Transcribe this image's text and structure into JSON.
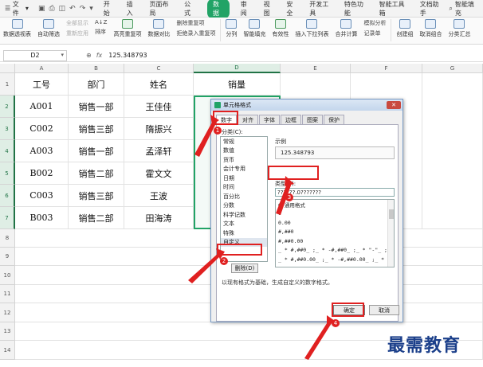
{
  "toolbar": {
    "file_label": "文件",
    "tabs": [
      "开始",
      "插入",
      "页面布局",
      "公式",
      "数据",
      "审阅",
      "视图",
      "安全",
      "开发工具",
      "特色功能",
      "智能工具箱",
      "文档助手"
    ],
    "active_tab": "数据",
    "search_label": "智能填充"
  },
  "ribbon": {
    "pivot": "数据透视表",
    "autofilter": "自动筛选",
    "show_all": "全部显示",
    "reapply": "重新应用",
    "sort_az": "A↓Z",
    "sort_label": "排序",
    "highlight_dup": "高亮重复项",
    "compare": "数据对比",
    "del_dup": "删除重复项",
    "reject_dup": "拒绝录入重复项",
    "split": "分列",
    "smart_fill": "智能填充",
    "validity": "有效性",
    "dropdown": "插入下拉列表",
    "merge_calc": "合并计算",
    "mock": "模拟分析",
    "record": "记录单",
    "create_group": "创建组",
    "ungroup": "取消组合",
    "subtotal": "分类汇总"
  },
  "formula_bar": {
    "cell_ref": "D2",
    "fx": "fx",
    "value": "125.348793"
  },
  "sheet": {
    "columns": [
      "A",
      "B",
      "C",
      "D",
      "E",
      "F",
      "G"
    ],
    "rows": [
      "1",
      "2",
      "3",
      "4",
      "5",
      "6",
      "7",
      "8",
      "9",
      "10",
      "11",
      "12",
      "13",
      "14"
    ],
    "data": [
      [
        "工号",
        "部门",
        "姓名",
        "销量"
      ],
      [
        "A001",
        "销售一部",
        "王佳佳",
        ""
      ],
      [
        "C002",
        "销售三部",
        "隋振兴",
        ""
      ],
      [
        "A003",
        "销售一部",
        "孟泽轩",
        ""
      ],
      [
        "B002",
        "销售二部",
        "霍文文",
        ""
      ],
      [
        "C003",
        "销售三部",
        "王波",
        ""
      ],
      [
        "B003",
        "销售二部",
        "田海涛",
        ""
      ]
    ]
  },
  "dialog": {
    "title": "单元格格式",
    "close": "✕",
    "tabs": [
      "数字",
      "对齐",
      "字体",
      "边框",
      "图案",
      "保护"
    ],
    "category_label": "分类(C):",
    "categories": [
      "常规",
      "数值",
      "货币",
      "会计专用",
      "日期",
      "时间",
      "百分比",
      "分数",
      "科学记数",
      "文本",
      "特殊",
      "自定义"
    ],
    "selected_category": "自定义",
    "sample_label": "示例",
    "sample_value": "125.348793",
    "type_label": "类型(T):",
    "type_value": "??????.0???????",
    "formats": [
      "G/通用格式",
      "0",
      "0.00",
      "#,##0",
      "#,##0.00",
      "_ * #,##0_ ;_ * -#,##0_ ;_ * \"-\"_ ;_ @_",
      "_ * #,##0.00_ ;_ * -#,##0.00_ ;_ * \"-\"??_ ;_ @_"
    ],
    "delete_label": "删除(D)",
    "hint": "以现有格式为基础，生成自定义的数字格式。",
    "ok_label": "确定",
    "cancel_label": "取消"
  },
  "annotations": {
    "step1": "1",
    "step2": "2",
    "step3": "3",
    "step4": "4",
    "color": "#e02020"
  },
  "watermark": "最需教育"
}
